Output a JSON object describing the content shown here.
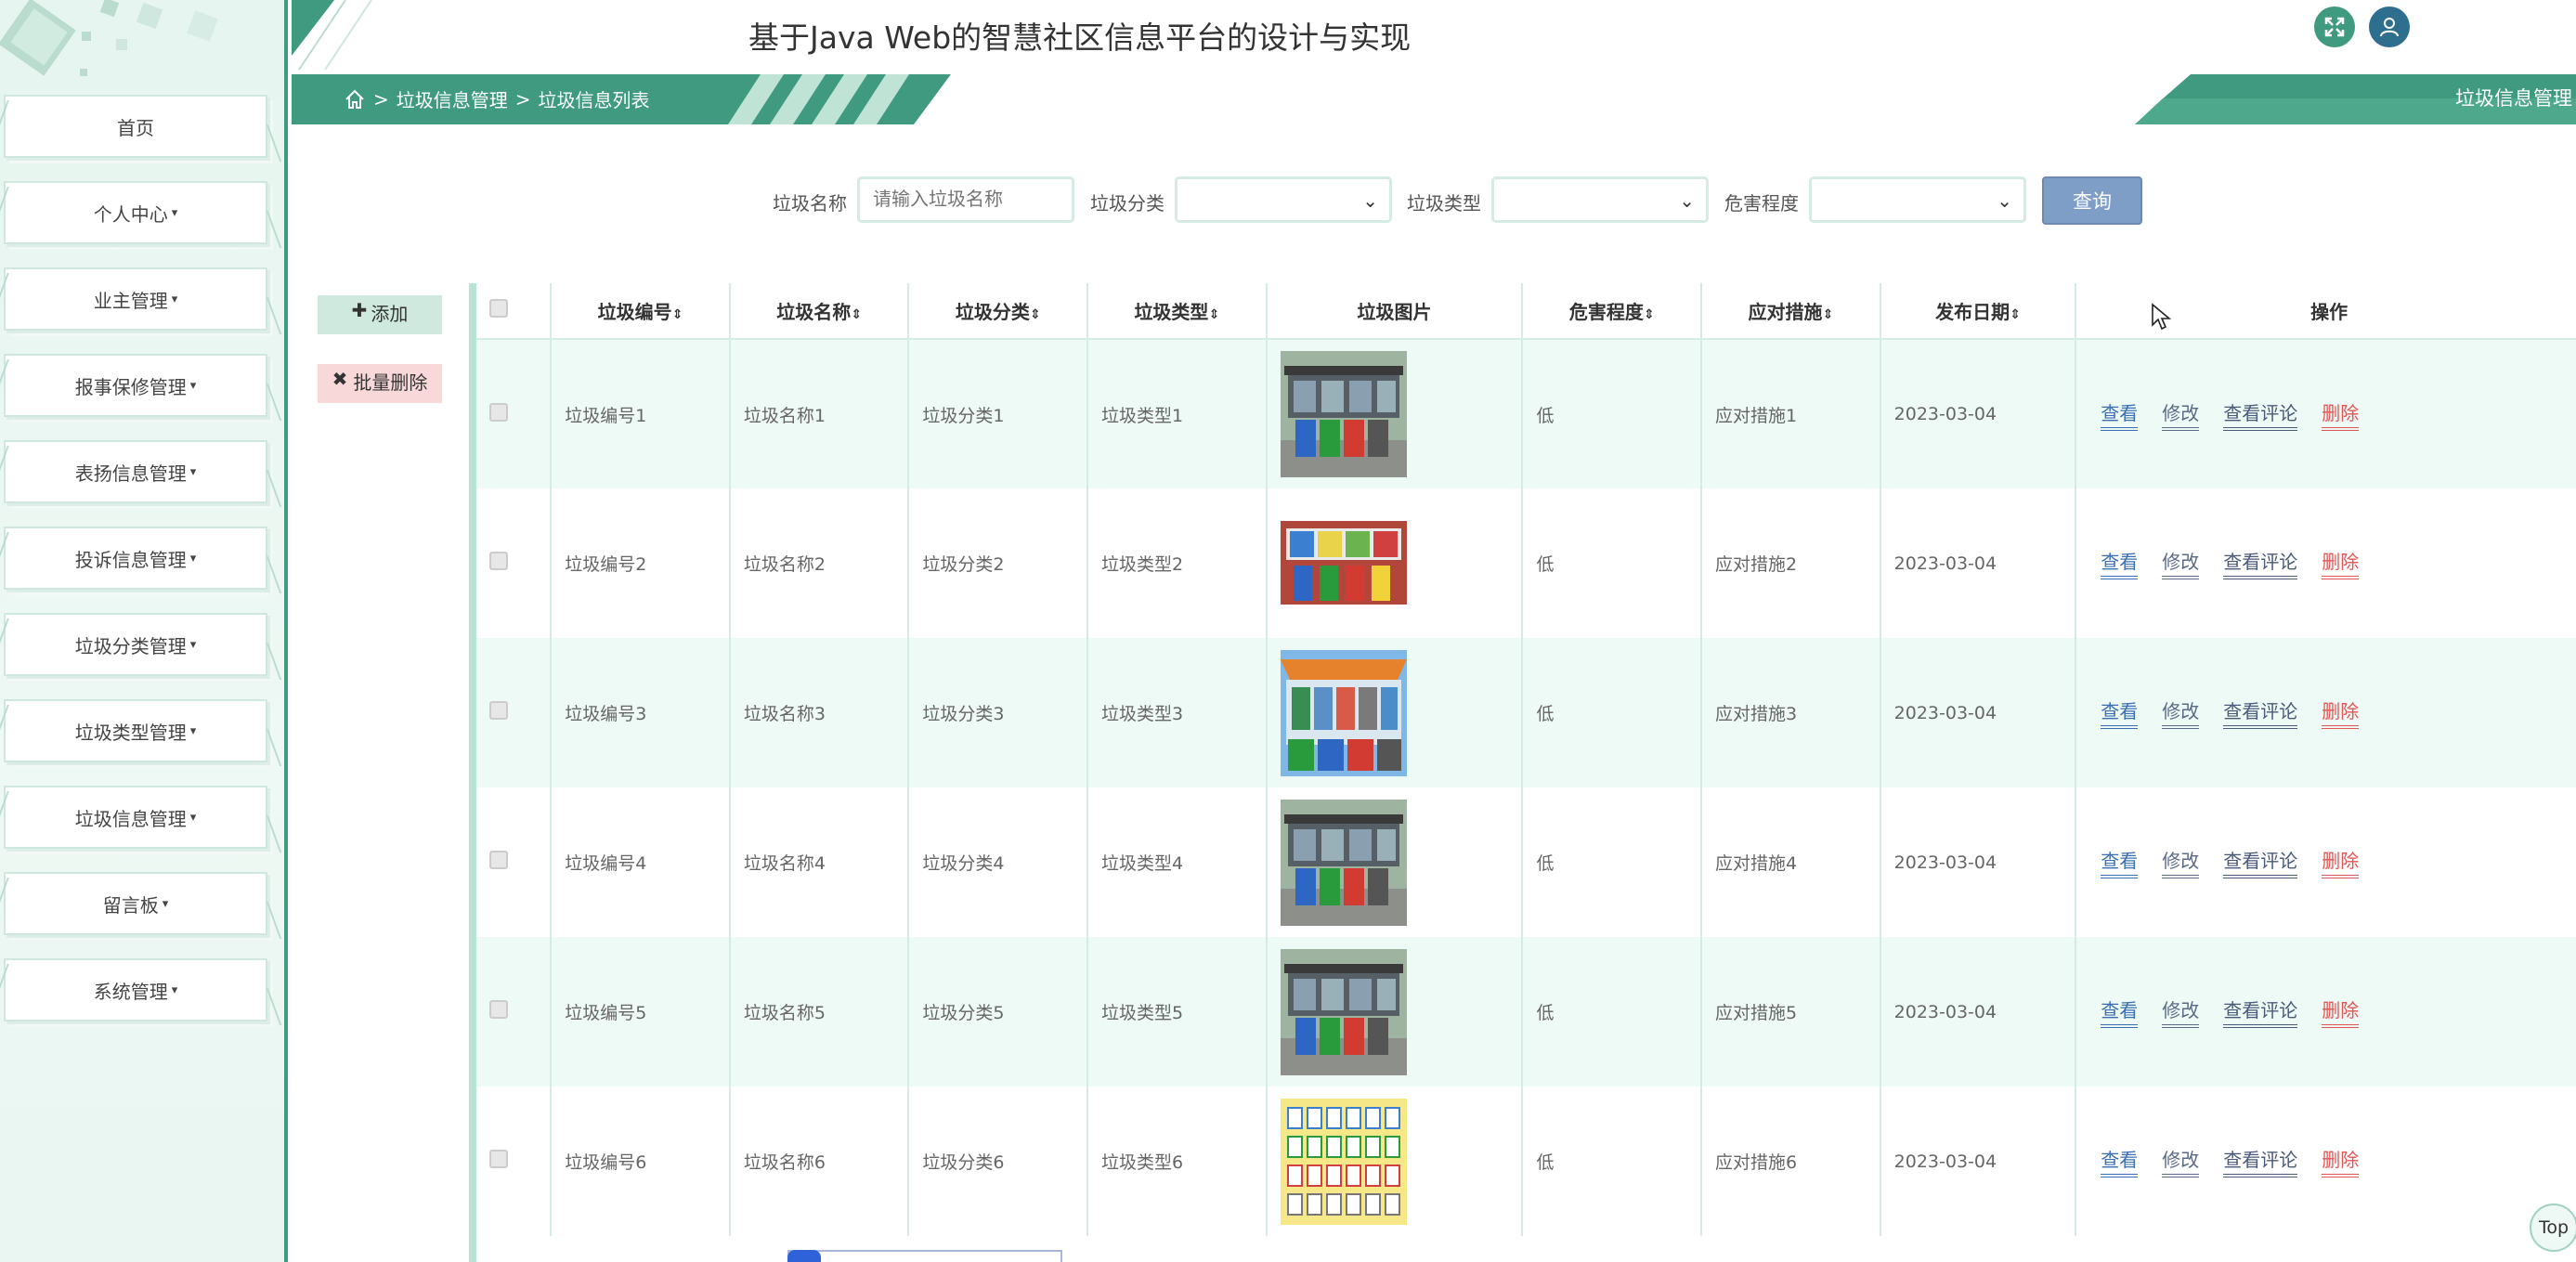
{
  "app": {
    "title": "基于Java Web的智慧社区信息平台的设计与实现",
    "top_button": "Top"
  },
  "header_buttons": [
    {
      "icon": "fullscreen-icon"
    },
    {
      "icon": "user-icon"
    }
  ],
  "sidebar": {
    "items": [
      {
        "label": "首页",
        "has_caret": false
      },
      {
        "label": "个人中心",
        "has_caret": true
      },
      {
        "label": "业主管理",
        "has_caret": true
      },
      {
        "label": "报事保修管理",
        "has_caret": true
      },
      {
        "label": "表扬信息管理",
        "has_caret": true
      },
      {
        "label": "投诉信息管理",
        "has_caret": true
      },
      {
        "label": "垃圾分类管理",
        "has_caret": true
      },
      {
        "label": "垃圾类型管理",
        "has_caret": true
      },
      {
        "label": "垃圾信息管理",
        "has_caret": true
      },
      {
        "label": "留言板",
        "has_caret": true
      },
      {
        "label": "系统管理",
        "has_caret": true
      }
    ]
  },
  "breadcrumb": {
    "items": [
      "垃圾信息管理",
      "垃圾信息列表"
    ],
    "separator": ">",
    "right_title": "垃圾信息管理"
  },
  "search": {
    "name_label": "垃圾名称",
    "name_placeholder": "请输入垃圾名称",
    "category_label": "垃圾分类",
    "type_label": "垃圾类型",
    "hazard_label": "危害程度",
    "submit_label": "查询"
  },
  "actions": {
    "add_label": "添加",
    "batch_delete_label": "批量删除"
  },
  "table": {
    "columns": [
      "垃圾编号",
      "垃圾名称",
      "垃圾分类",
      "垃圾类型",
      "垃圾图片",
      "危害程度",
      "应对措施",
      "发布日期",
      "操作"
    ],
    "ops": {
      "view": "查看",
      "edit": "修改",
      "comment": "查看评论",
      "delete": "删除"
    },
    "rows": [
      {
        "code": "垃圾编号1",
        "name": "垃圾名称1",
        "category": "垃圾分类1",
        "type": "垃圾类型1",
        "image": "recycling-station-photo",
        "hazard": "低",
        "measure": "应对措施1",
        "date": "2023-03-04"
      },
      {
        "code": "垃圾编号2",
        "name": "垃圾名称2",
        "category": "垃圾分类2",
        "type": "垃圾类型2",
        "image": "sorting-bins-photo",
        "hazard": "低",
        "measure": "应对措施2",
        "date": "2023-03-04"
      },
      {
        "code": "垃圾编号3",
        "name": "垃圾名称3",
        "category": "垃圾分类3",
        "type": "垃圾类型3",
        "image": "bin-shelter-photo",
        "hazard": "低",
        "measure": "应对措施3",
        "date": "2023-03-04"
      },
      {
        "code": "垃圾编号4",
        "name": "垃圾名称4",
        "category": "垃圾分类4",
        "type": "垃圾类型4",
        "image": "recycling-station-photo",
        "hazard": "低",
        "measure": "应对措施4",
        "date": "2023-03-04"
      },
      {
        "code": "垃圾编号5",
        "name": "垃圾名称5",
        "category": "垃圾分类5",
        "type": "垃圾类型5",
        "image": "recycling-station-photo",
        "hazard": "低",
        "measure": "应对措施5",
        "date": "2023-03-04"
      },
      {
        "code": "垃圾编号6",
        "name": "垃圾名称6",
        "category": "垃圾分类6",
        "type": "垃圾类型6",
        "image": "sorting-poster-photo",
        "hazard": "低",
        "measure": "应对措施6",
        "date": "2023-03-04"
      }
    ]
  },
  "colors": {
    "accent": "#3f9a80",
    "row_alt": "#eefaf5",
    "query_button": "#7e9ec8",
    "delete": "#e05555"
  }
}
